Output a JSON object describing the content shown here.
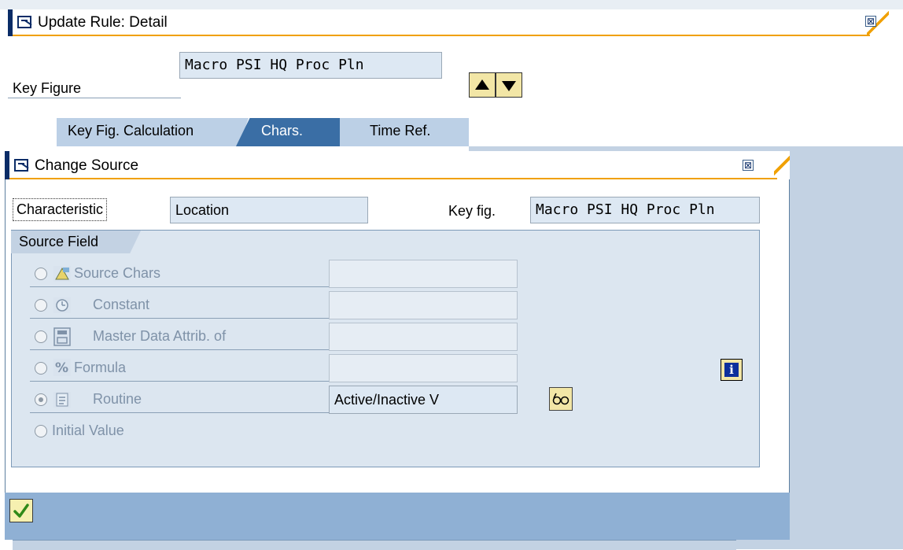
{
  "window": {
    "title": "Update Rule: Detail",
    "close_label": "⊠"
  },
  "header": {
    "key_figure_label": "Key Figure",
    "key_figure_value": "Macro PSI HQ Proc Pln"
  },
  "tabs": [
    {
      "label": "Key Fig. Calculation"
    },
    {
      "label": "Chars."
    },
    {
      "label": "Time Ref."
    }
  ],
  "dialog": {
    "title": "Change Source",
    "close_label": "⊠",
    "characteristic_label": "Characteristic",
    "characteristic_value": "Location",
    "keyfig_label": "Key fig.",
    "keyfig_value": "Macro PSI HQ Proc Pln",
    "group_title": "Source Field",
    "options": [
      {
        "label": "Source Chars",
        "value": ""
      },
      {
        "label": "Constant",
        "value": ""
      },
      {
        "label": "Master Data Attrib. of",
        "value": ""
      },
      {
        "label": "Formula",
        "value": ""
      },
      {
        "label": "Routine",
        "value": "Active/Inactive V"
      },
      {
        "label": "Initial Value",
        "value": ""
      }
    ],
    "selected_option": "Routine"
  },
  "colors": {
    "accent_orange": "#f0a000",
    "sap_blue_dark": "#0a2c67",
    "panel_blue": "#c3d2e3",
    "ok_green": "#2f8a18"
  }
}
